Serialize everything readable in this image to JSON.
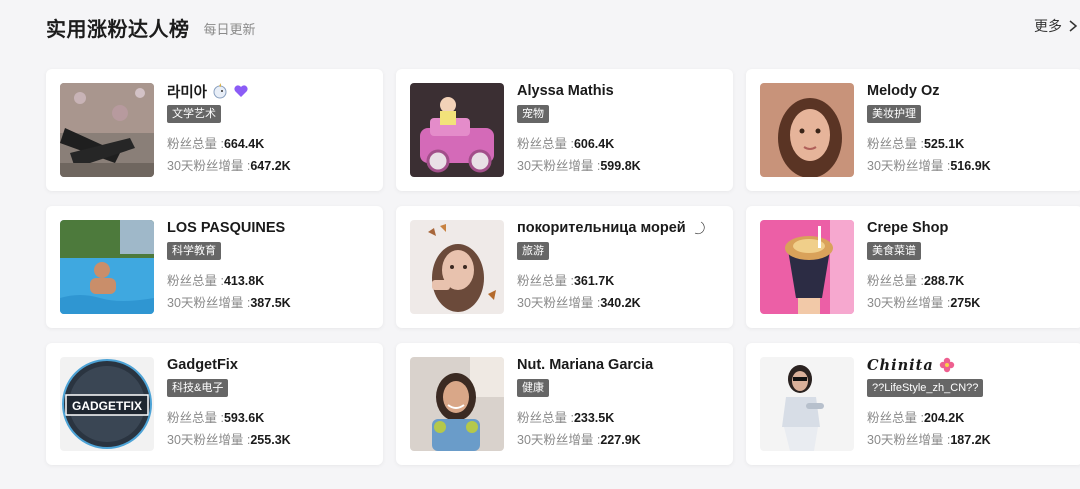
{
  "header": {
    "title": "实用涨粉达人榜",
    "subtitle": "每日更新",
    "more_label": "更多"
  },
  "cards": [
    {
      "name": "라미아",
      "tag": "文学艺术",
      "total_label": "粉丝总量 :",
      "total": "664.4K",
      "growth_label": "30天粉丝增量 :",
      "growth": "647.2K",
      "emoji": "unicorn-and-purple-heart-emoji"
    },
    {
      "name": "Alyssa Mathis",
      "tag": "宠物",
      "total_label": "粉丝总量 :",
      "total": "606.4K",
      "growth_label": "30天粉丝增量 :",
      "growth": "599.8K"
    },
    {
      "name": "Melody Oz",
      "tag": "美妆护理",
      "total_label": "粉丝总量 :",
      "total": "525.1K",
      "growth_label": "30天粉丝增量 :",
      "growth": "516.9K"
    },
    {
      "name": "LOS PASQUINES",
      "tag": "科学教育",
      "total_label": "粉丝总量 :",
      "total": "413.8K",
      "growth_label": "30天粉丝增量 :",
      "growth": "387.5K"
    },
    {
      "name": "покорительница морей",
      "tag": "旅游",
      "total_label": "粉丝总量 :",
      "total": "361.7K",
      "growth_label": "30天粉丝增量 :",
      "growth": "340.2K",
      "emoji": "crescent-moon-emoji"
    },
    {
      "name": "Crepe Shop",
      "tag": "美食菜谱",
      "total_label": "粉丝总量 :",
      "total": "288.7K",
      "growth_label": "30天粉丝增量 :",
      "growth": "275K"
    },
    {
      "name": "GadgetFix",
      "tag": "科技&电子",
      "total_label": "粉丝总量 :",
      "total": "593.6K",
      "growth_label": "30天粉丝增量 :",
      "growth": "255.3K",
      "avatar_text": "GADGETFIX"
    },
    {
      "name": "Nut. Mariana Garcia",
      "tag": "健康",
      "total_label": "粉丝总量 :",
      "total": "233.5K",
      "growth_label": "30天粉丝增量 :",
      "growth": "227.9K"
    },
    {
      "name": "𝑪𝒉𝒊𝒏𝒊𝒕𝒂",
      "tag": "??LifeStyle_zh_CN??",
      "total_label": "粉丝总量 :",
      "total": "204.2K",
      "growth_label": "30天粉丝增量 :",
      "growth": "187.2K",
      "emoji": "hibiscus-emoji"
    }
  ],
  "colors": {
    "background": "#f5f5f7",
    "card": "#ffffff",
    "tag": "#666666"
  }
}
